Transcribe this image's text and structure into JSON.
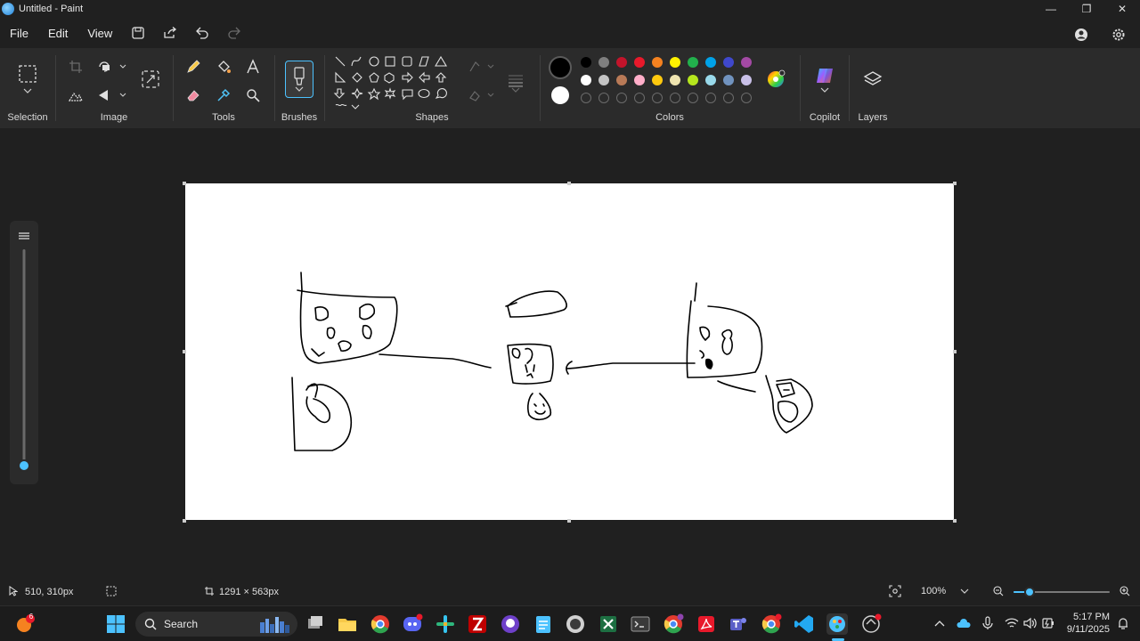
{
  "window": {
    "title": "Untitled - Paint"
  },
  "menu": {
    "file": "File",
    "edit": "Edit",
    "view": "View"
  },
  "ribbon": {
    "selection_label": "Selection",
    "image_label": "Image",
    "tools_label": "Tools",
    "brushes_label": "Brushes",
    "shapes_label": "Shapes",
    "colors_label": "Colors",
    "copilot_label": "Copilot",
    "layers_label": "Layers"
  },
  "colors": {
    "primary": "#000000",
    "secondary": "#ffffff",
    "row1": [
      "#000000",
      "#7f7f7f",
      "#c3142b",
      "#e8192b",
      "#f58220",
      "#fff200",
      "#22b14c",
      "#00a2e8",
      "#3f48cc",
      "#a349a4"
    ],
    "row2": [
      "#ffffff",
      "#c3c3c3",
      "#b97a57",
      "#ffaec9",
      "#ffc90e",
      "#efe4b0",
      "#b5e61d",
      "#99d9ea",
      "#7092be",
      "#c8bfe7"
    ]
  },
  "status": {
    "cursor_position": "510, 310px",
    "canvas_size": "1291 × 563px",
    "zoom": "100%"
  },
  "taskbar": {
    "search_placeholder": "Search",
    "time": "5:17 PM",
    "date": "9/11/2025",
    "notification_count": "6"
  }
}
